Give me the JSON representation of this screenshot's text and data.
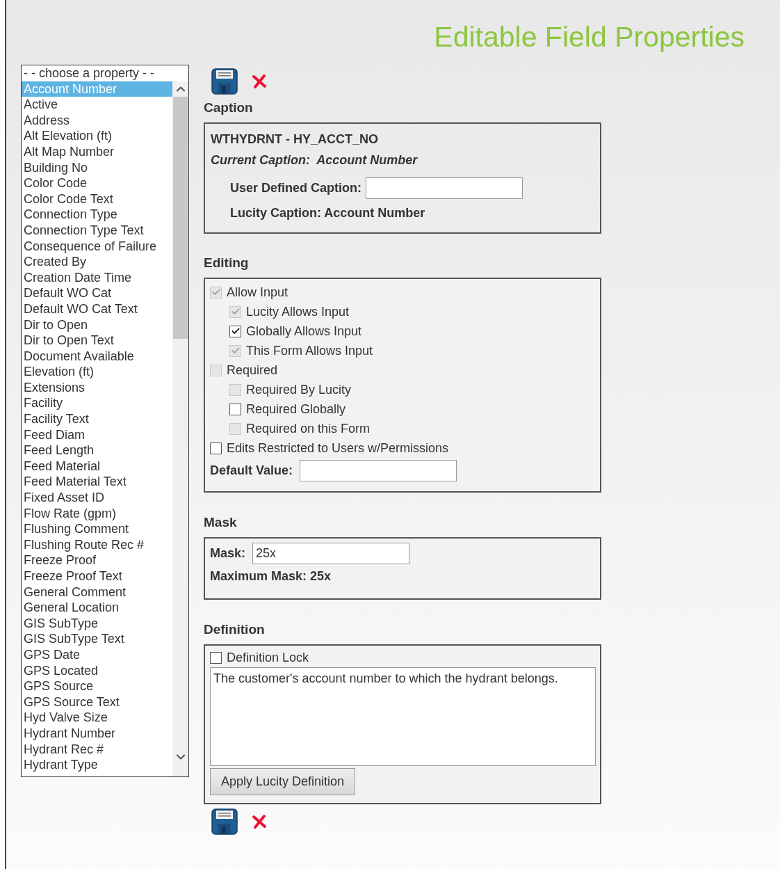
{
  "title": "Editable Field Properties",
  "property_list": {
    "placeholder_option": "- - choose a property - -",
    "items": [
      {
        "label": "Account Number",
        "selected": true
      },
      {
        "label": "Active",
        "selected": false
      },
      {
        "label": "Address",
        "selected": false
      },
      {
        "label": "Alt Elevation (ft)",
        "selected": false
      },
      {
        "label": "Alt Map Number",
        "selected": false
      },
      {
        "label": "Building No",
        "selected": false
      },
      {
        "label": "Color Code",
        "selected": false
      },
      {
        "label": "Color Code Text",
        "selected": false
      },
      {
        "label": "Connection Type",
        "selected": false
      },
      {
        "label": "Connection Type Text",
        "selected": false
      },
      {
        "label": "Consequence of Failure",
        "selected": false
      },
      {
        "label": "Created By",
        "selected": false
      },
      {
        "label": "Creation Date Time",
        "selected": false
      },
      {
        "label": "Default WO Cat",
        "selected": false
      },
      {
        "label": "Default WO Cat Text",
        "selected": false
      },
      {
        "label": "Dir to Open",
        "selected": false
      },
      {
        "label": "Dir to Open Text",
        "selected": false
      },
      {
        "label": "Document Available",
        "selected": false
      },
      {
        "label": "Elevation (ft)",
        "selected": false
      },
      {
        "label": "Extensions",
        "selected": false
      },
      {
        "label": "Facility",
        "selected": false
      },
      {
        "label": "Facility Text",
        "selected": false
      },
      {
        "label": "Feed Diam",
        "selected": false
      },
      {
        "label": "Feed Length",
        "selected": false
      },
      {
        "label": "Feed Material",
        "selected": false
      },
      {
        "label": "Feed Material Text",
        "selected": false
      },
      {
        "label": "Fixed Asset ID",
        "selected": false
      },
      {
        "label": "Flow Rate (gpm)",
        "selected": false
      },
      {
        "label": "Flushing Comment",
        "selected": false
      },
      {
        "label": "Flushing Route Rec #",
        "selected": false
      },
      {
        "label": "Freeze Proof",
        "selected": false
      },
      {
        "label": "Freeze Proof Text",
        "selected": false
      },
      {
        "label": "General Comment",
        "selected": false
      },
      {
        "label": "General Location",
        "selected": false
      },
      {
        "label": "GIS SubType",
        "selected": false
      },
      {
        "label": "GIS SubType Text",
        "selected": false
      },
      {
        "label": "GPS Date",
        "selected": false
      },
      {
        "label": "GPS Located",
        "selected": false
      },
      {
        "label": "GPS Source",
        "selected": false
      },
      {
        "label": "GPS Source Text",
        "selected": false
      },
      {
        "label": "Hyd Valve Size",
        "selected": false
      },
      {
        "label": "Hydrant Number",
        "selected": false
      },
      {
        "label": "Hydrant Rec #",
        "selected": false
      },
      {
        "label": "Hydrant Type",
        "selected": false
      }
    ]
  },
  "caption": {
    "heading": "Caption",
    "field_name": "WTHYDRNT - HY_ACCT_NO",
    "current_caption": "Current Caption:  Account Number",
    "user_defined_label": "User Defined Caption:",
    "lucity_caption": "Lucity Caption: Account Number"
  },
  "editing": {
    "heading": "Editing",
    "checkboxes": [
      {
        "label": "Allow Input",
        "checked": true,
        "disabled": true,
        "children": [
          {
            "label": "Lucity Allows Input",
            "checked": true,
            "disabled": true
          },
          {
            "label": "Globally Allows Input",
            "checked": true,
            "disabled": false
          },
          {
            "label": "This Form Allows Input",
            "checked": true,
            "disabled": true
          }
        ]
      },
      {
        "label": "Required",
        "checked": false,
        "disabled": true,
        "children": [
          {
            "label": "Required By Lucity",
            "checked": false,
            "disabled": true
          },
          {
            "label": "Required Globally",
            "checked": false,
            "disabled": false
          },
          {
            "label": "Required on this Form",
            "checked": false,
            "disabled": true
          }
        ]
      },
      {
        "label": "Edits Restricted to Users w/Permissions",
        "checked": false,
        "disabled": false
      }
    ],
    "default_value_label": "Default Value:"
  },
  "mask": {
    "heading": "Mask",
    "label": "Mask:",
    "value": "25x",
    "maximum": "Maximum Mask: 25x"
  },
  "definition": {
    "heading": "Definition",
    "lock": {
      "label": "Definition Lock",
      "checked": false,
      "disabled": false
    },
    "text": "The customer's account number to which the hydrant belongs.",
    "apply_button": "Apply Lucity Definition"
  }
}
